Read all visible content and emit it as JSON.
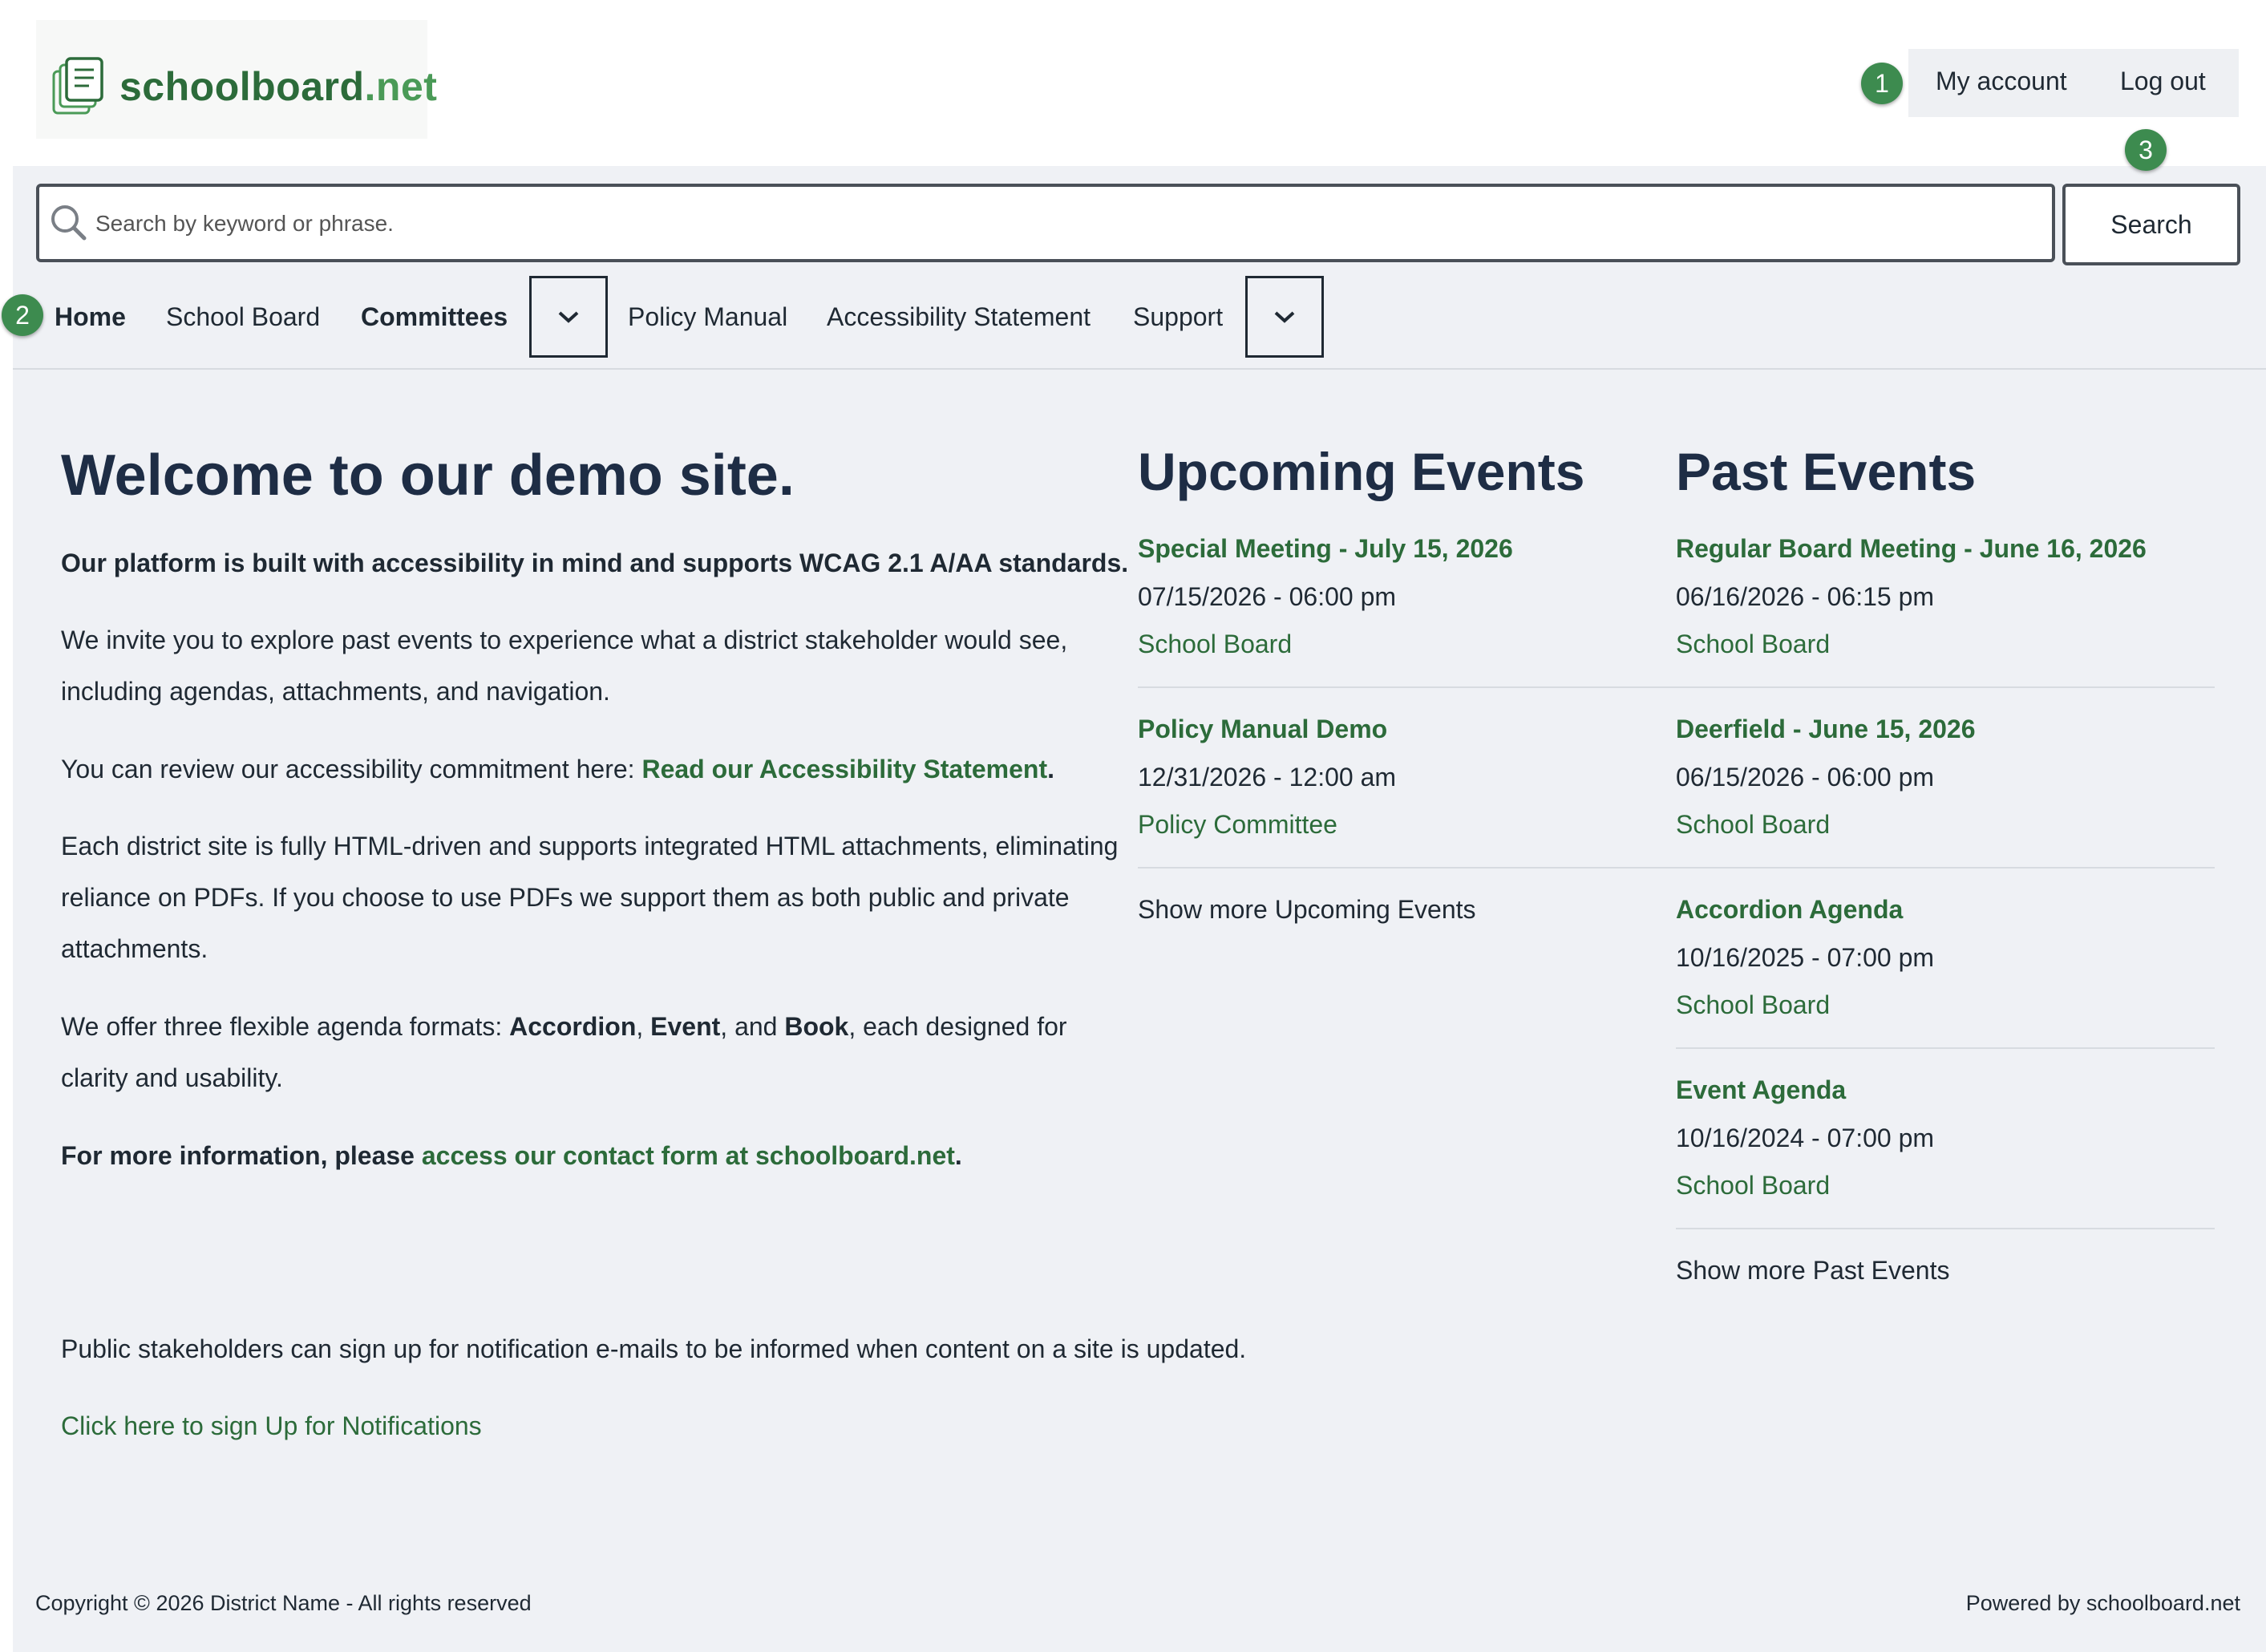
{
  "header": {
    "logo": {
      "name": "schoolboard",
      "tld": ".net"
    },
    "account": {
      "my_account": "My account",
      "log_out": "Log out"
    },
    "badges": [
      "1",
      "2",
      "3"
    ]
  },
  "search": {
    "placeholder": "Search by keyword or phrase.",
    "button": "Search"
  },
  "nav": {
    "items": [
      "Home",
      "School Board",
      "Committees",
      "Policy Manual",
      "Accessibility Statement",
      "Support"
    ]
  },
  "main": {
    "title": "Welcome to our demo site.",
    "intro_bold": "Our platform is built with accessibility in mind and supports WCAG 2.1 A/AA standards.",
    "p1_line1": "We invite you to explore past events to experience what a district stakeholder would see,",
    "p1_line2": "including agendas, attachments, and navigation.",
    "p2_text": "You can review our accessibility commitment here: ",
    "p2_link": "Read our Accessibility Statement",
    "p2_end": ".",
    "p3_line1": "Each district site is fully HTML-driven and supports integrated HTML attachments, eliminating",
    "p3_line2": "reliance on PDFs. If you choose to use PDFs we support them as both public and private",
    "p3_line3": "attachments.",
    "p4_pre": "We offer three flexible agenda formats: ",
    "p4_f1": "Accordion",
    "p4_sep1": ", ",
    "p4_f2": "Event",
    "p4_sep2": ", and ",
    "p4_f3": "Book",
    "p4_post": ", each designed for",
    "p4_line2": "clarity and usability.",
    "p5_pre": "For more information, please ",
    "p5_link": "access our contact form at schoolboard.net",
    "p5_end": ".",
    "p6": "Public stakeholders can sign up for notification e-mails to be informed when content on a site is updated.",
    "signup_link": "Click here to sign Up for Notifications"
  },
  "upcoming": {
    "heading": "Upcoming Events",
    "events": [
      {
        "title": "Special Meeting - July 15, 2026",
        "date": "07/15/2026 - 06:00 pm",
        "committee": "School Board"
      },
      {
        "title": "Policy Manual Demo",
        "date": "12/31/2026 - 12:00 am",
        "committee": "Policy Committee"
      }
    ],
    "show_more": "Show more Upcoming Events"
  },
  "past": {
    "heading": "Past Events",
    "events": [
      {
        "title": "Regular Board Meeting - June 16, 2026",
        "date": "06/16/2026 - 06:15 pm",
        "committee": "School Board"
      },
      {
        "title": "Deerfield - June 15, 2026",
        "date": "06/15/2026 - 06:00 pm",
        "committee": "School Board"
      },
      {
        "title": "Accordion Agenda",
        "date": "10/16/2025 - 07:00 pm",
        "committee": "School Board"
      },
      {
        "title": "Event Agenda",
        "date": "10/16/2024 - 07:00 pm",
        "committee": "School Board"
      }
    ],
    "show_more": "Show more Past Events"
  },
  "footer": {
    "copyright": "Copyright © 2026 District Name - All rights reserved",
    "powered": "Powered by schoolboard.net"
  },
  "colors": {
    "brand_green": "#2c6b3a",
    "badge_green": "#3d8b4f",
    "heading_navy": "#1e2d45",
    "background": "#eff1f5"
  }
}
